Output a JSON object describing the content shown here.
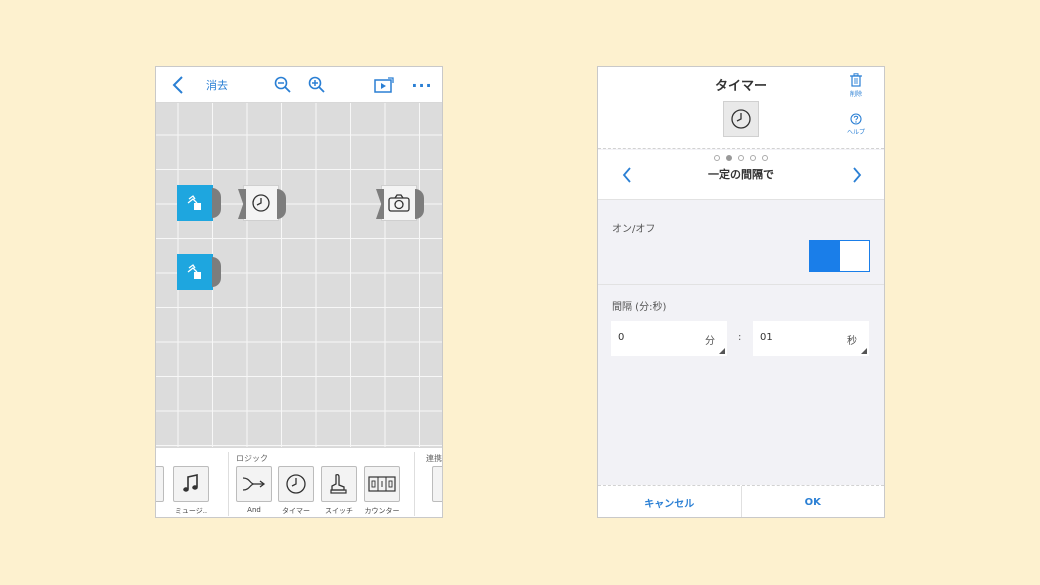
{
  "left_screen": {
    "toolbar": {
      "erase_label": "消去",
      "back_icon": "chevron-left-icon",
      "zoom_out_icon": "zoom-out-icon",
      "zoom_in_icon": "zoom-in-icon",
      "play_icon": "play-icon",
      "more_label": "···"
    },
    "canvas_blocks": [
      {
        "type": "block-blue",
        "icon": "touch-trigger-icon"
      },
      {
        "type": "block-gray",
        "icon": "timer-icon"
      },
      {
        "type": "block-gray",
        "icon": "camera-icon"
      },
      {
        "type": "block-blue",
        "icon": "touch-trigger-icon"
      }
    ],
    "palette": {
      "group_logic": "ロジック",
      "group_next": "連携",
      "items": [
        {
          "label": "ミュージ..",
          "icon": "music-note-icon"
        },
        {
          "label": "And",
          "icon": "and-gate-icon"
        },
        {
          "label": "タイマー",
          "icon": "timer-icon"
        },
        {
          "label": "スイッチ",
          "icon": "switch-icon"
        },
        {
          "label": "カウンター",
          "icon": "counter-icon"
        }
      ]
    }
  },
  "right_screen": {
    "title": "タイマー",
    "delete_label": "削除",
    "help_label": "ヘルプ",
    "nav": {
      "label": "一定の間隔で",
      "pages": 5,
      "active_page": 2
    },
    "onoff_label": "オン/オフ",
    "toggle_state": "on",
    "interval_label": "間隔 (分:秒)",
    "minutes": {
      "value": "0",
      "unit": "分"
    },
    "seconds": {
      "value": "01",
      "unit": "秒"
    },
    "separator": ":",
    "footer": {
      "cancel": "キャンセル",
      "ok": "OK"
    },
    "accent_color": "#1a7ee9"
  }
}
